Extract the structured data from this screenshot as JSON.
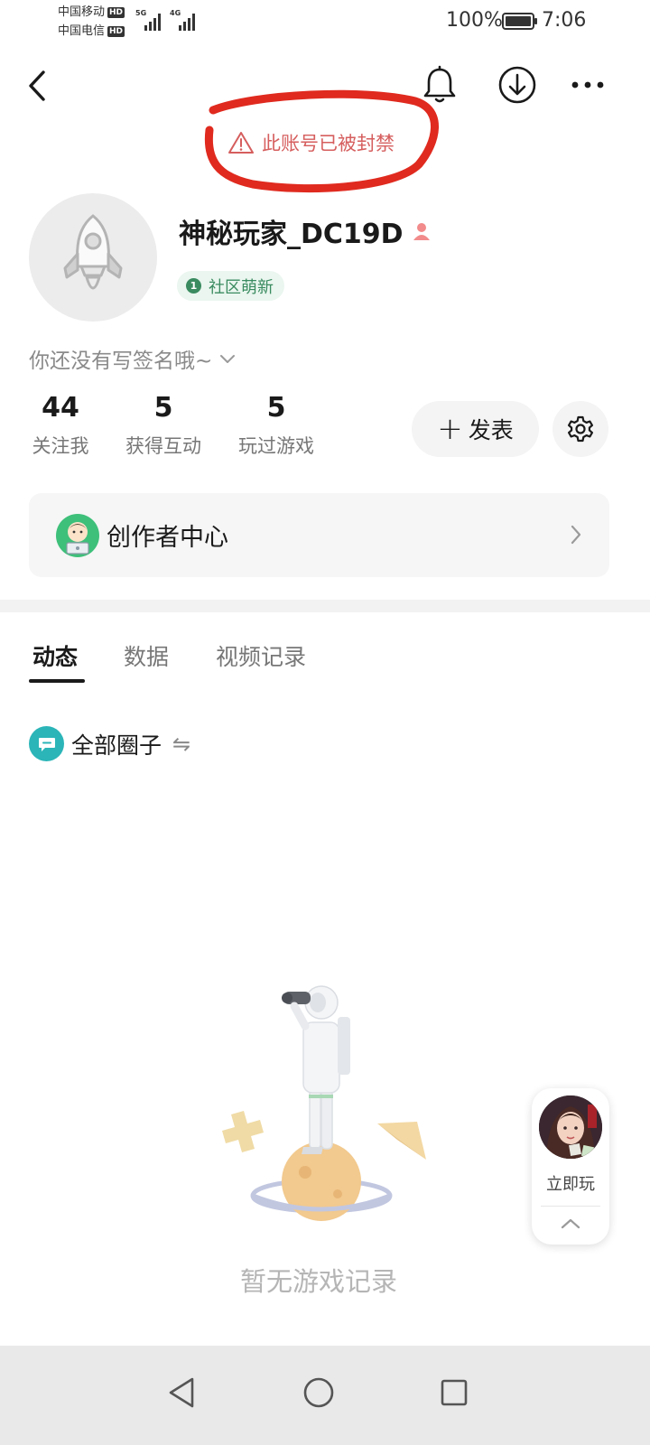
{
  "status_bar": {
    "carrier1": "中国移动",
    "carrier2": "中国电信",
    "hd": "HD",
    "net1": "5G",
    "net2": "4G",
    "battery_pct": "100%",
    "time": "7:06"
  },
  "header": {
    "back_icon": "back-arrow-icon",
    "icons": [
      "bell-icon",
      "download-icon",
      "more-icon"
    ],
    "ban_notice": "此账号已被封禁",
    "annotation_color": "#e02a1f"
  },
  "profile": {
    "username": "神秘玩家_DC19D",
    "level_number": "1",
    "level_label": "社区萌新",
    "signature": "你还没有写签名哦~",
    "stats": [
      {
        "value": "44",
        "label": "关注我"
      },
      {
        "value": "5",
        "label": "获得互动"
      },
      {
        "value": "5",
        "label": "玩过游戏"
      }
    ],
    "post_button_label": "发表",
    "post_button_icon": "+"
  },
  "creator_center": {
    "label": "创作者中心"
  },
  "tabs": [
    {
      "label": "动态",
      "active": true
    },
    {
      "label": "数据",
      "active": false
    },
    {
      "label": "视频记录",
      "active": false
    }
  ],
  "circle_filter": {
    "label": "全部圈子",
    "swap_icon": "⇋"
  },
  "empty_state": {
    "text": "暂无游戏记录"
  },
  "floating_game": {
    "label": "立即玩"
  },
  "colors": {
    "ban_text": "#d65e5e",
    "level_green": "#3a8b60",
    "circle_teal": "#2bb5b8"
  }
}
